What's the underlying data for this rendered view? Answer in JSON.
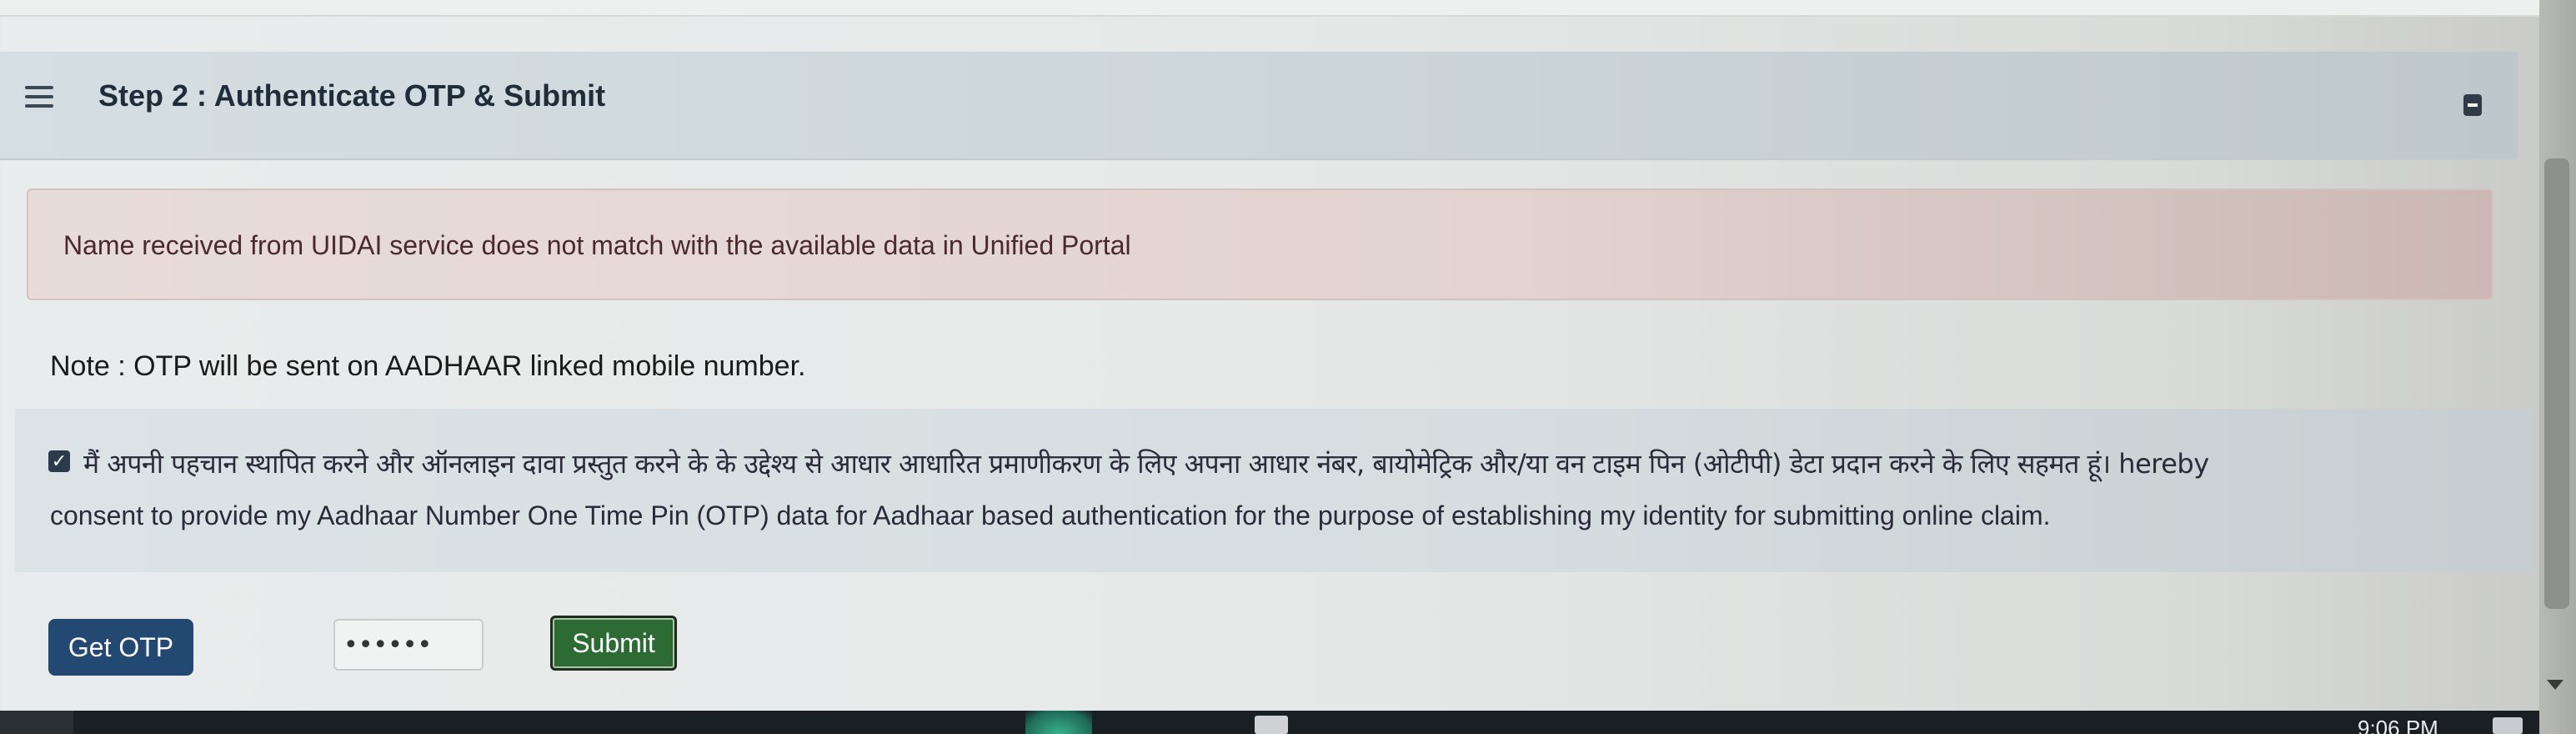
{
  "card": {
    "title": "Step 2 : Authenticate OTP & Submit",
    "menu_icon": "hamburger-menu-icon",
    "collapse_icon": "minus-square-icon"
  },
  "alert": {
    "message": "Name received from UIDAI service does not match with the available data in Unified Portal"
  },
  "note": {
    "text": "Note : OTP will be sent on AADHAAR linked mobile number."
  },
  "consent": {
    "checked": true,
    "hindi_text": "मैं अपनी पहचान स्थापित करने और ऑनलाइन दावा प्रस्तुत करने के के उद्देश्य से आधार आधारित प्रमाणीकरण के लिए अपना आधार नंबर, बायोमेट्रिक और/या वन टाइम पिन (ओटीपी) डेटा प्रदान करने के लिए सहमत हूं। hereby",
    "english_text": "consent to provide my Aadhaar Number One Time Pin (OTP) data for Aadhaar based authentication for the purpose of establishing my identity for submitting online claim."
  },
  "actions": {
    "get_otp_label": "Get OTP",
    "otp_value": "••••••",
    "submit_label": "Submit"
  },
  "taskbar": {
    "clock": "9:06 PM"
  },
  "colors": {
    "header_bg": "#cfd8dc",
    "alert_bg": "#e5d7d5",
    "consent_bg": "#d9e0e3",
    "get_otp_bg": "#234872",
    "submit_bg": "#2c6b34"
  }
}
